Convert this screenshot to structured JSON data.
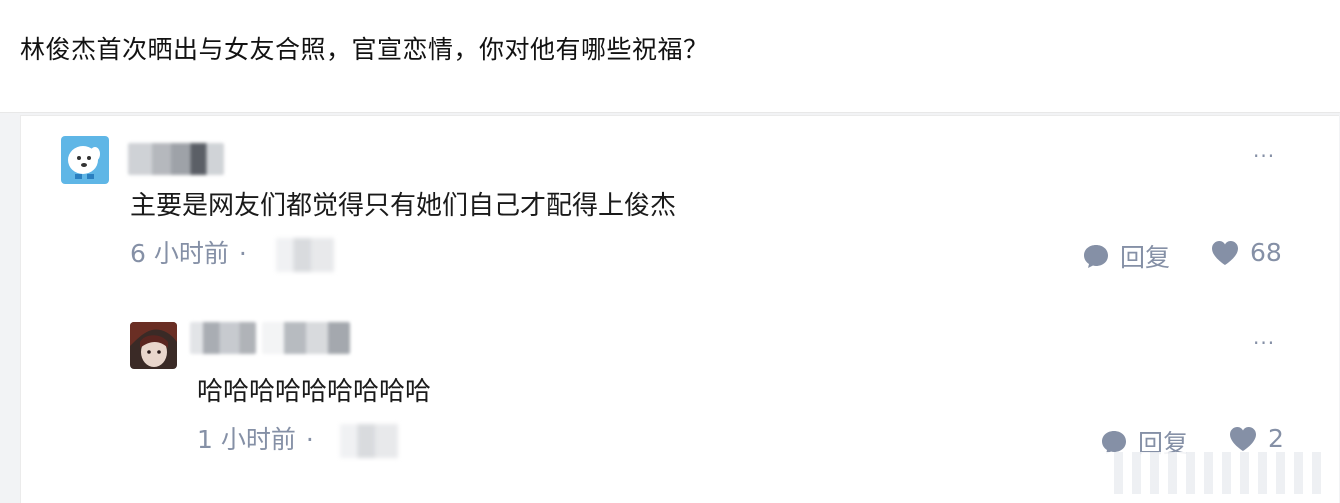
{
  "question": {
    "title": "林俊杰首次晒出与女友合照，官宣恋情，你对他有哪些祝福？"
  },
  "comments": [
    {
      "author_avatar_icon": "dog-avatar-icon",
      "content": "主要是网友们都觉得只有她们自己才配得上俊杰",
      "time": "6 小时前",
      "separator": "·",
      "more": "···",
      "reply_label": "回复",
      "like_count": "68"
    },
    {
      "author_avatar_icon": "anime-avatar-icon",
      "content": "哈哈哈哈哈哈哈哈哈",
      "time": "1 小时前",
      "separator": "·",
      "more": "···",
      "reply_label": "回复",
      "like_count": "2"
    }
  ],
  "colors": {
    "muted": "#8590a6",
    "text": "#1a1a1a",
    "panel_bg": "#ffffff",
    "page_bg": "#f2f3f5"
  }
}
